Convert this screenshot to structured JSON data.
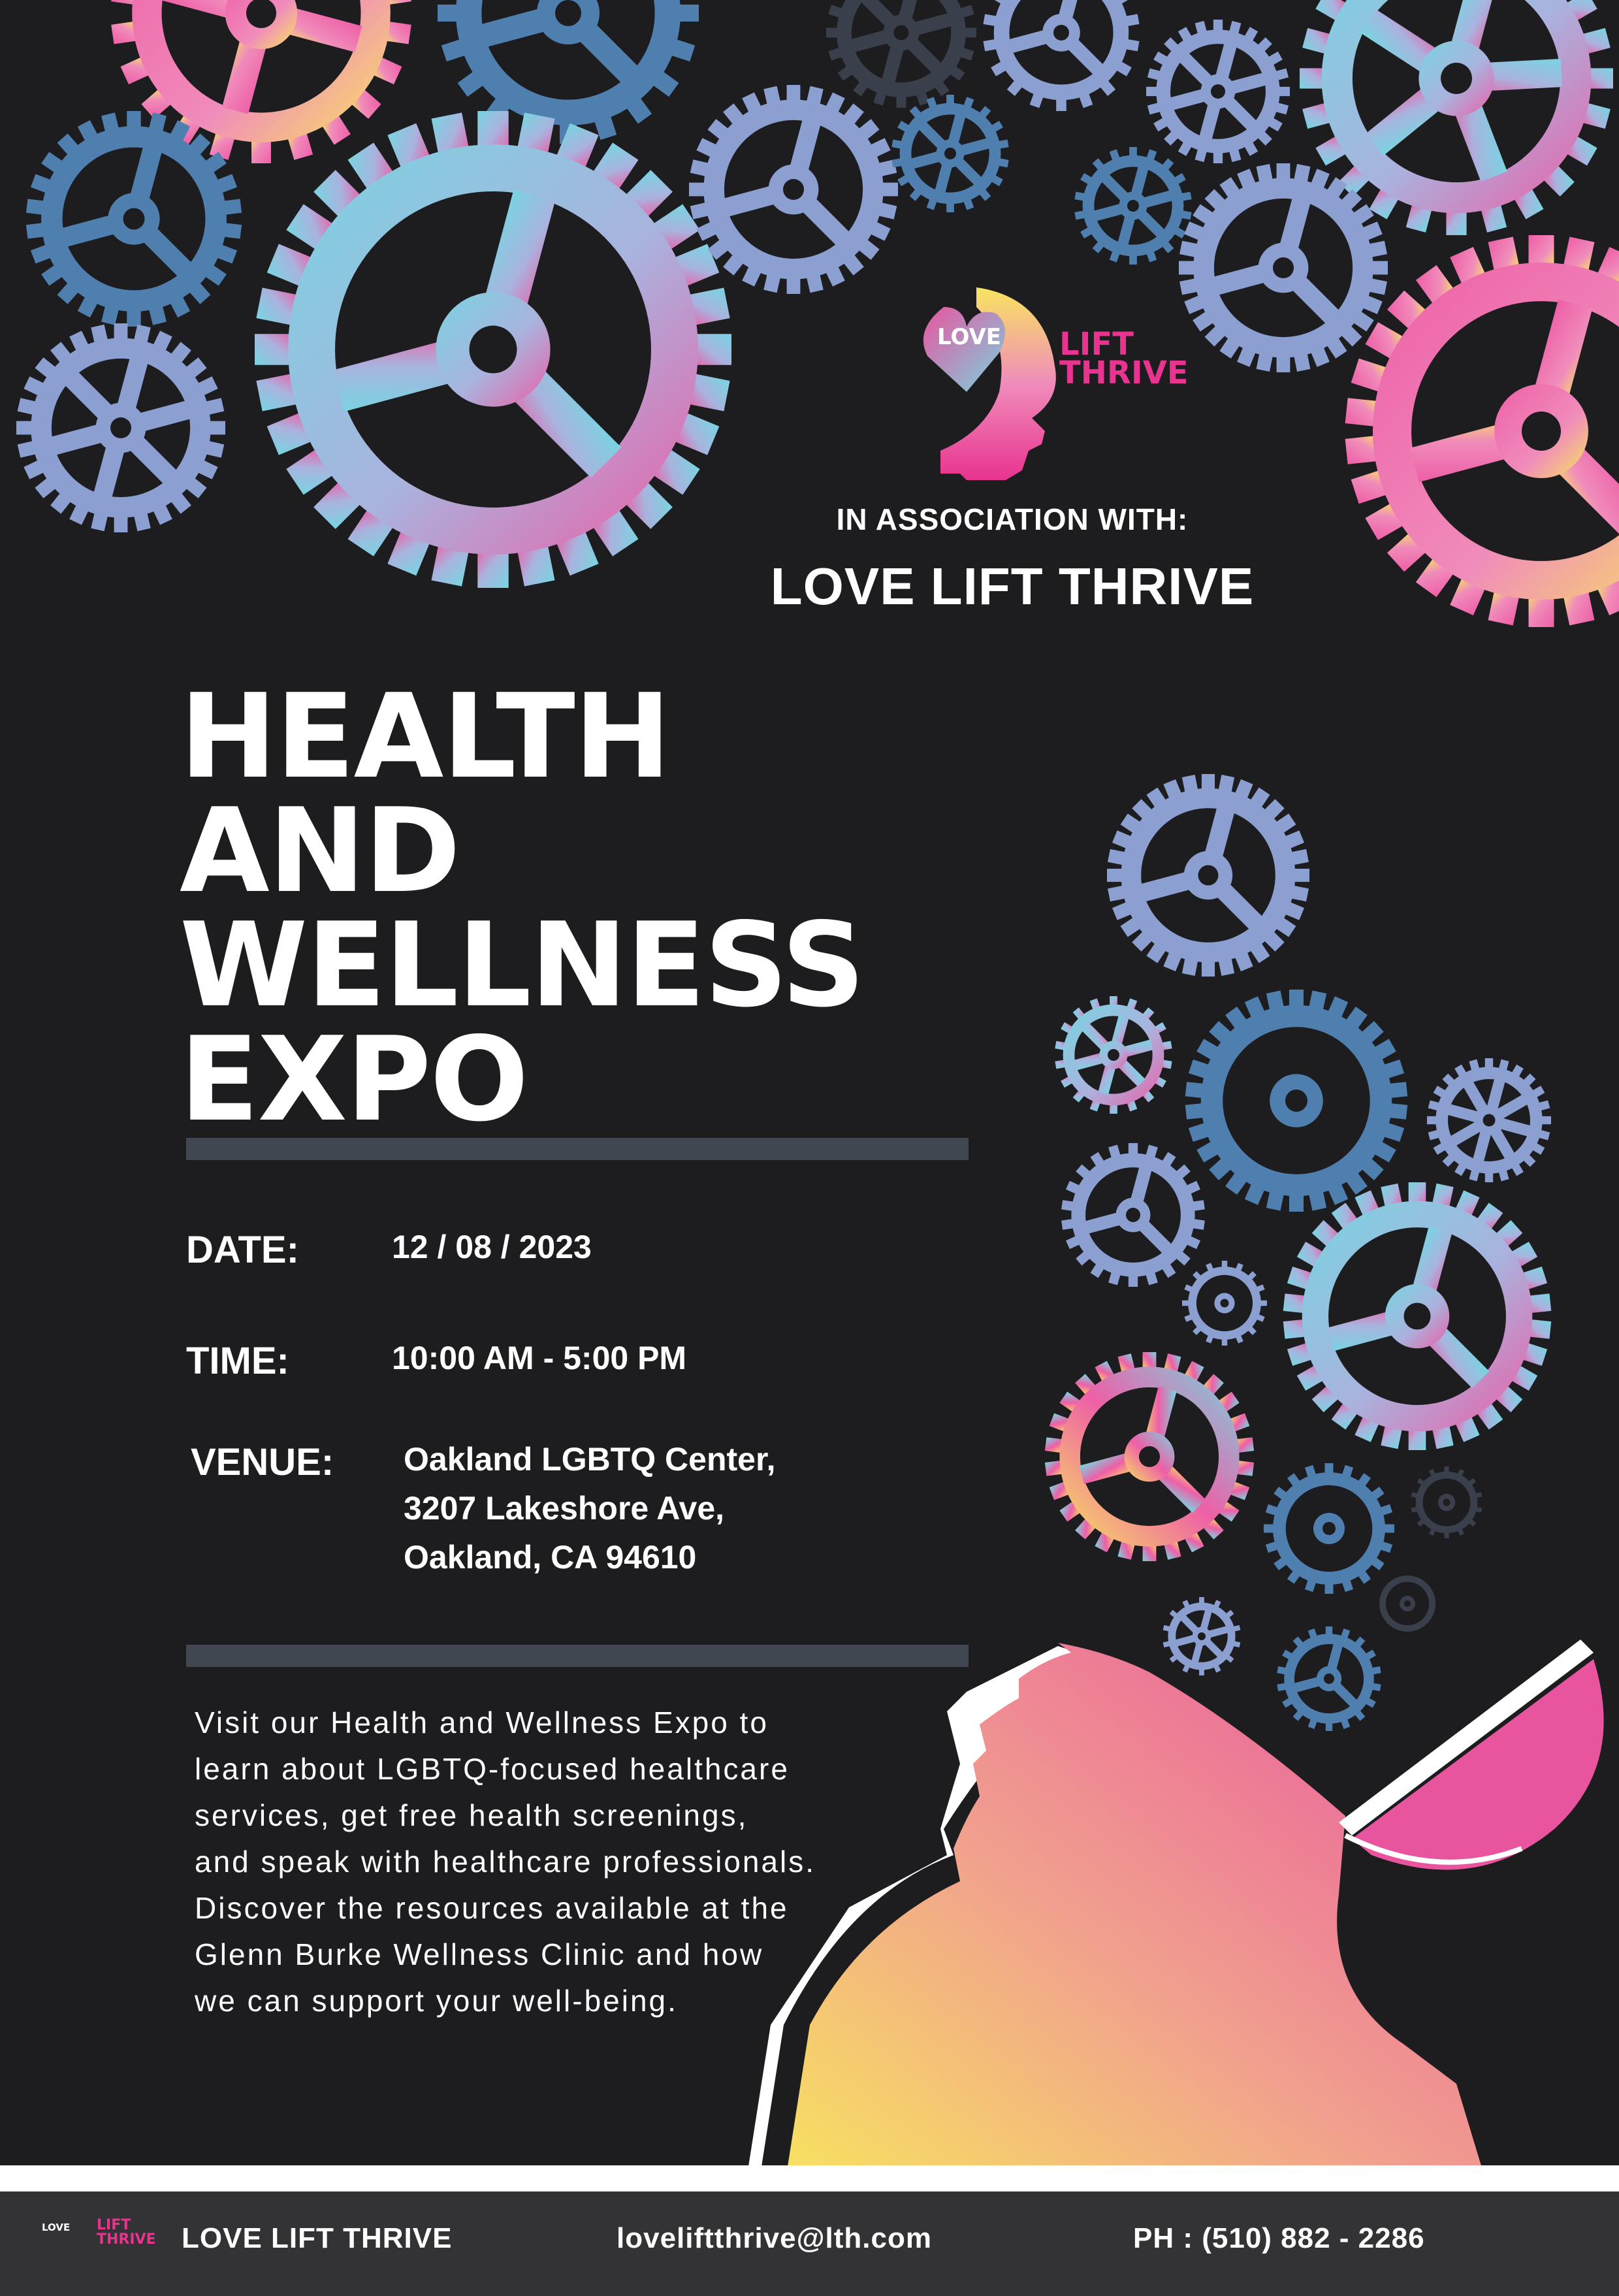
{
  "logo": {
    "love": "LOVE",
    "lift": "LIFT",
    "thrive": "THRIVE"
  },
  "association_label": "IN ASSOCIATION WITH:",
  "association_org": "LOVE LIFT THRIVE",
  "title_lines": [
    "HEALTH",
    "AND",
    "WELLNESS",
    "EXPO"
  ],
  "details": {
    "date_label": "DATE:",
    "date_value": "12 / 08 / 2023",
    "time_label": "TIME:",
    "time_value": "10:00 AM - 5:00 PM",
    "venue_label": "VENUE:",
    "venue_lines": [
      "Oakland LGBTQ Center,",
      "3207 Lakeshore Ave,",
      "Oakland, CA 94610"
    ]
  },
  "description_lines": [
    "Visit our Health and Wellness Expo to",
    "learn about LGBTQ-focused healthcare",
    "services, get free health screenings,",
    "and speak with healthcare professionals.",
    "Discover the resources available at the",
    "Glenn Burke Wellness Clinic and how",
    "we can support your well-being."
  ],
  "footer": {
    "name": "LOVE LIFT THRIVE",
    "email": "loveliftthrive@lth.com",
    "phone": "PH : (510) 882 - 2286"
  },
  "colors": {
    "background": "#1d1c1f",
    "divider": "#404750",
    "footer_bg": "#333336",
    "gear_blue": "#4f7fae",
    "gear_lavender": "#8b9fd0",
    "gear_dark": "#3a3f4c",
    "pink": "#e8338f",
    "cyan": "#79d4e0",
    "yellow": "#f7e463"
  }
}
